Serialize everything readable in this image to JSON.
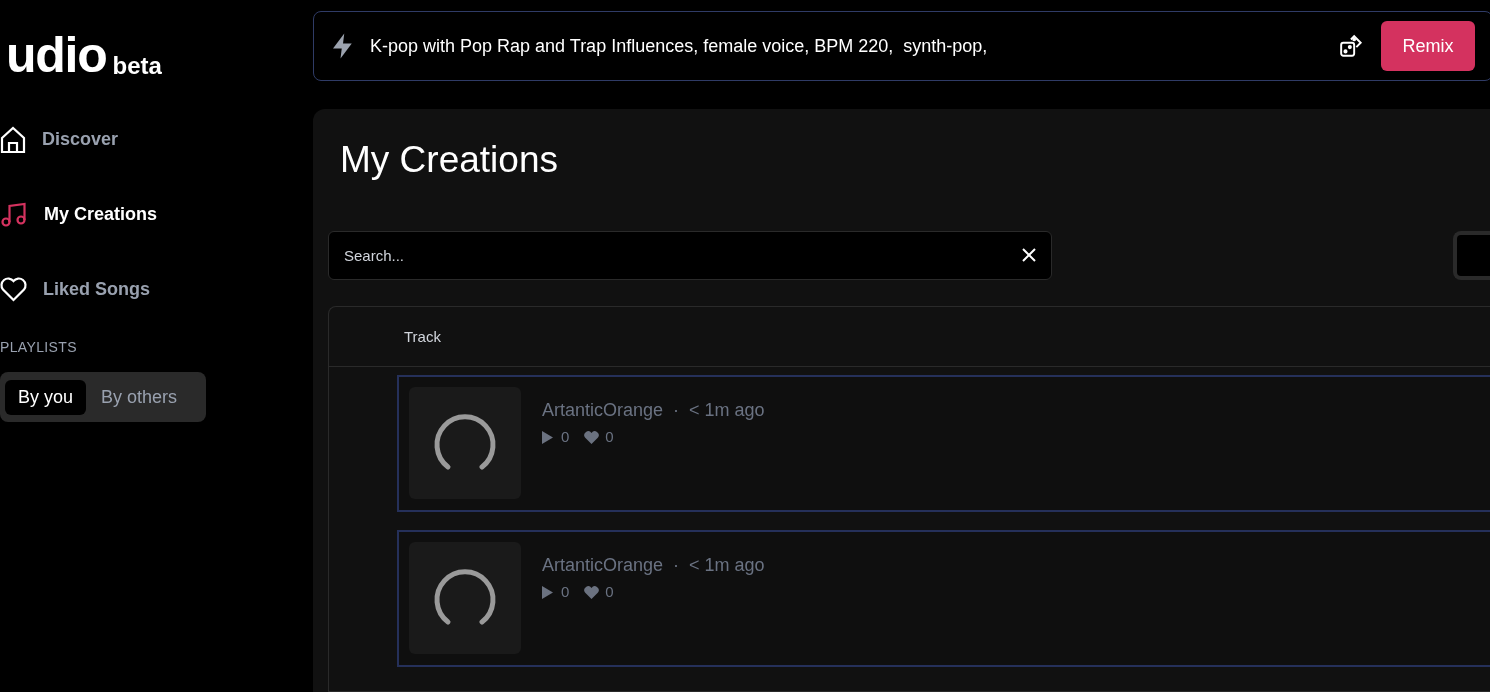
{
  "logo": {
    "name": "udio",
    "badge": "beta"
  },
  "nav": [
    {
      "label": "Discover",
      "selected": false
    },
    {
      "label": "My Creations",
      "selected": true
    },
    {
      "label": "Liked Songs",
      "selected": false
    }
  ],
  "playlists": {
    "heading": "PLAYLISTS",
    "tabs": [
      {
        "label": "By you",
        "selected": true
      },
      {
        "label": "By others",
        "selected": false
      }
    ]
  },
  "prompt": {
    "value": "K-pop with Pop Rap and Trap Influences, female voice, BPM 220,  synth-pop,",
    "button": "Remix"
  },
  "page_title": "My Creations",
  "search": {
    "placeholder": "Search..."
  },
  "table": {
    "columns": [
      "Track"
    ],
    "rows": [
      {
        "author": "ArtanticOrange",
        "separator": "·",
        "time": "< 1m ago",
        "plays": "0",
        "likes": "0"
      },
      {
        "author": "ArtanticOrange",
        "separator": "·",
        "time": "< 1m ago",
        "plays": "0",
        "likes": "0"
      }
    ]
  }
}
